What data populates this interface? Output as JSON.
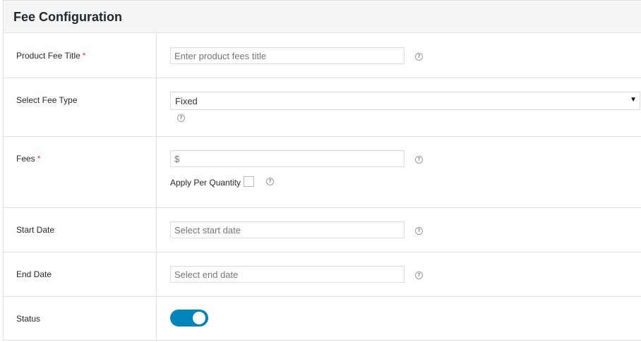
{
  "panel": {
    "title": "Fee Configuration"
  },
  "fields": {
    "product_fee_title": {
      "label": "Product Fee Title",
      "required_mark": "*",
      "placeholder": "Enter product fees title",
      "help": "?"
    },
    "fee_type": {
      "label": "Select Fee Type",
      "selected": "Fixed",
      "arrow": "▼",
      "help": "?"
    },
    "fees": {
      "label": "Fees",
      "required_mark": "*",
      "placeholder": "$",
      "help": "?",
      "apply_per_quantity": {
        "label": "Apply Per Quantity",
        "checked": false,
        "help": "?"
      }
    },
    "start_date": {
      "label": "Start Date",
      "placeholder": "Select start date",
      "help": "?"
    },
    "end_date": {
      "label": "End Date",
      "placeholder": "Select end date",
      "help": "?"
    },
    "status": {
      "label": "Status",
      "enabled": true
    }
  },
  "colors": {
    "toggle_on": "#0085ba",
    "required": "#dc3232",
    "header_bg": "#f5f5f5"
  }
}
